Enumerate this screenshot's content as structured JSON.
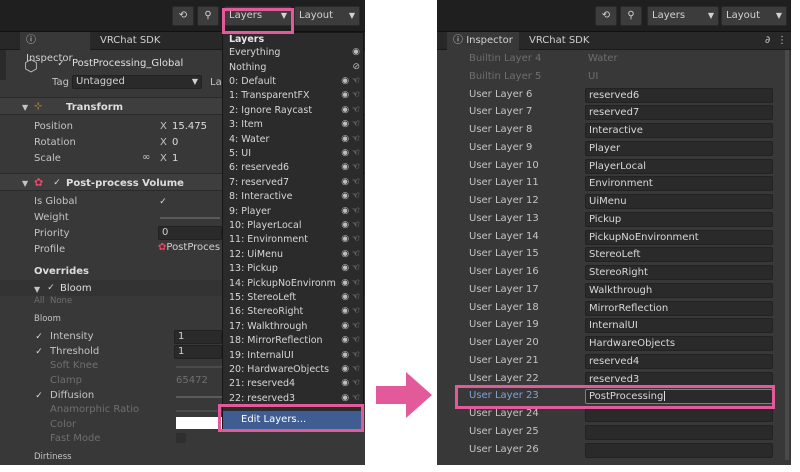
{
  "left": {
    "toolbar": {
      "layers_label": "Layers",
      "layout_label": "Layout",
      "history_icon": "history-icon",
      "search_icon": "search-icon"
    },
    "tabs": {
      "inspector": "Inspector",
      "vrchat": "VRChat SDK"
    },
    "gameobject": {
      "name": "PostProcessing_Global",
      "tag_label": "Tag",
      "tag_value": "Untagged",
      "layer_label": "La"
    },
    "transform": {
      "title": "Transform",
      "position": "Position",
      "rotation": "Rotation",
      "scale": "Scale",
      "x_label": "X",
      "pos_x": "15.475",
      "rot_x": "0",
      "scale_x": "1"
    },
    "volume": {
      "title": "Post-process Volume",
      "is_global": "Is Global",
      "weight": "Weight",
      "priority": "Priority",
      "priority_value": "0",
      "profile": "Profile",
      "profile_value": "PostProces"
    },
    "overrides": {
      "title": "Overrides",
      "bloom": "Bloom",
      "all": "All",
      "none": "None",
      "bloom_section": "Bloom",
      "intensity": "Intensity",
      "intensity_value": "1",
      "threshold": "Threshold",
      "threshold_value": "1",
      "soft_knee": "Soft Knee",
      "clamp": "Clamp",
      "clamp_value": "65472",
      "diffusion": "Diffusion",
      "anamorphic": "Anamorphic Ratio",
      "color": "Color",
      "fast_mode": "Fast Mode",
      "dirtiness": "Dirtiness"
    },
    "layers_menu": {
      "heading": "Layers",
      "items": [
        "Everything",
        "Nothing",
        "0: Default",
        "1: TransparentFX",
        "2: Ignore Raycast",
        "3: Item",
        "4: Water",
        "5: UI",
        "6: reserved6",
        "7: reserved7",
        "8: Interactive",
        "9: Player",
        "10: PlayerLocal",
        "11: Environment",
        "12: UiMenu",
        "13: Pickup",
        "14: PickupNoEnvironm",
        "15: StereoLeft",
        "16: StereoRight",
        "17: Walkthrough",
        "18: MirrorReflection",
        "19: InternalUI",
        "20: HardwareObjects",
        "21: reserved4",
        "22: reserved3"
      ],
      "edit": "Edit Layers..."
    }
  },
  "right": {
    "toolbar": {
      "layers_label": "Layers",
      "layout_label": "Layout"
    },
    "tabs": {
      "inspector": "Inspector",
      "vrchat": "VRChat SDK"
    },
    "layers": [
      {
        "name": "Builtin Layer 4",
        "value": "Water"
      },
      {
        "name": "Builtin Layer 5",
        "value": "UI"
      },
      {
        "name": "User Layer 6",
        "value": "reserved6"
      },
      {
        "name": "User Layer 7",
        "value": "reserved7"
      },
      {
        "name": "User Layer 8",
        "value": "Interactive"
      },
      {
        "name": "User Layer 9",
        "value": "Player"
      },
      {
        "name": "User Layer 10",
        "value": "PlayerLocal"
      },
      {
        "name": "User Layer 11",
        "value": "Environment"
      },
      {
        "name": "User Layer 12",
        "value": "UiMenu"
      },
      {
        "name": "User Layer 13",
        "value": "Pickup"
      },
      {
        "name": "User Layer 14",
        "value": "PickupNoEnvironment"
      },
      {
        "name": "User Layer 15",
        "value": "StereoLeft"
      },
      {
        "name": "User Layer 16",
        "value": "StereoRight"
      },
      {
        "name": "User Layer 17",
        "value": "Walkthrough"
      },
      {
        "name": "User Layer 18",
        "value": "MirrorReflection"
      },
      {
        "name": "User Layer 19",
        "value": "InternalUI"
      },
      {
        "name": "User Layer 20",
        "value": "HardwareObjects"
      },
      {
        "name": "User Layer 21",
        "value": "reserved4"
      },
      {
        "name": "User Layer 22",
        "value": "reserved3"
      },
      {
        "name": "User Layer 23",
        "value": "PostProcessing"
      },
      {
        "name": "User Layer 24",
        "value": ""
      },
      {
        "name": "User Layer 25",
        "value": ""
      },
      {
        "name": "User Layer 26",
        "value": ""
      }
    ]
  },
  "colors": {
    "highlight": "#e35a9a",
    "arrow": "#e35a9a",
    "selection": "#3f5d91"
  }
}
